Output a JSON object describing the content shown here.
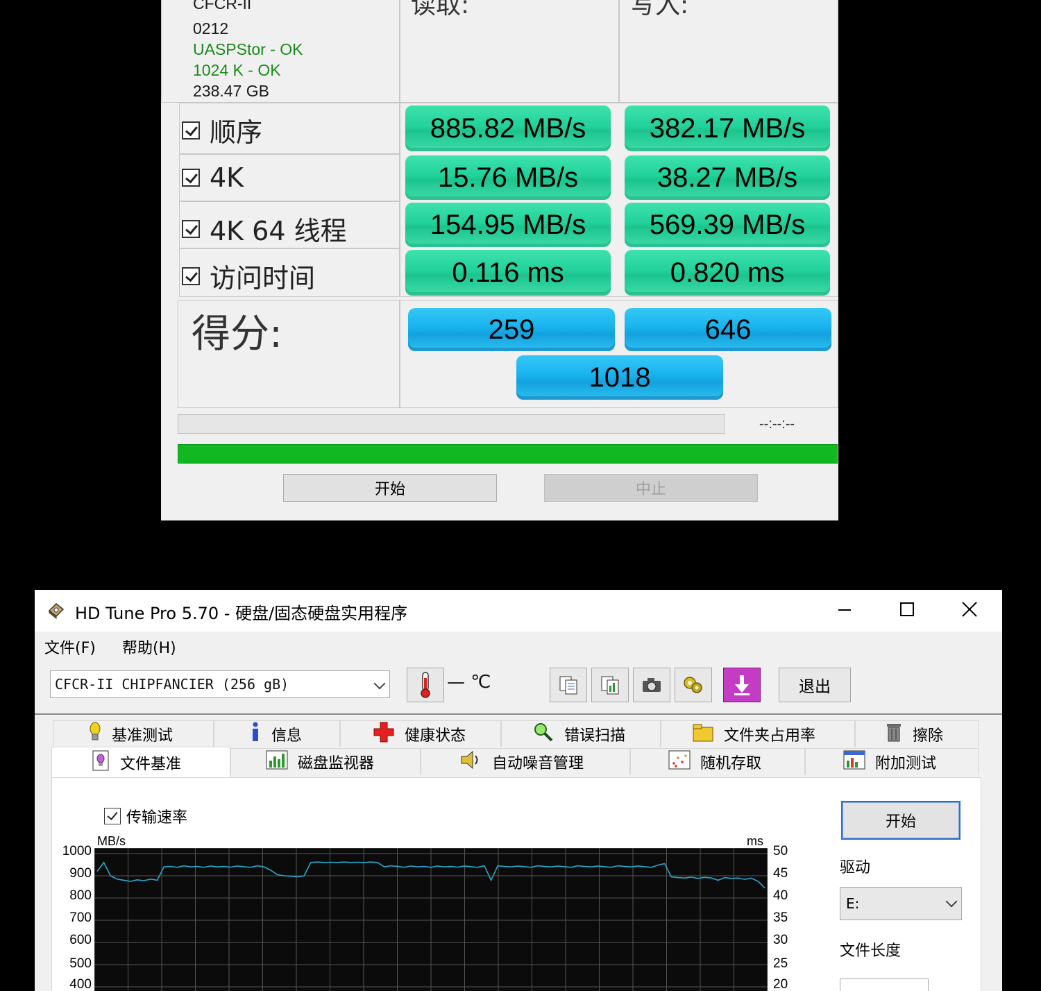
{
  "asssd": {
    "device": {
      "line1": "CFCR-II",
      "line2": "0212",
      "driver_status": "UASPStor - OK",
      "align_status": "1024 K - OK",
      "capacity": "238.47 GB"
    },
    "headers": {
      "read": "读取:",
      "write": "写入:"
    },
    "rows": [
      {
        "label": "顺序",
        "read": "885.82 MB/s",
        "write": "382.17 MB/s",
        "checked": true
      },
      {
        "label": "4K",
        "read": "15.76 MB/s",
        "write": "38.27 MB/s",
        "checked": true
      },
      {
        "label": "4K 64 线程",
        "read": "154.95 MB/s",
        "write": "569.39 MB/s",
        "checked": true
      },
      {
        "label": "访问时间",
        "read": "0.116 ms",
        "write": "0.820 ms",
        "checked": true
      }
    ],
    "score": {
      "label": "得分:",
      "read": "259",
      "write": "646",
      "total": "1018"
    },
    "time_display": "--:--:--",
    "overall_progress": 1.0,
    "buttons": {
      "start": "开始",
      "abort": "中止"
    },
    "colors": {
      "result_green": "#22d19b",
      "score_blue": "#19b2ee",
      "progress_green": "#12b822"
    }
  },
  "hdtune": {
    "title": "HD Tune Pro 5.70 - 硬盘/固态硬盘实用程序",
    "menu": {
      "file": "文件(F)",
      "help": "帮助(H)"
    },
    "toolbar": {
      "drive": "CFCR-II CHIPFANCIER (256 gB)",
      "temperature": "— ℃",
      "icons": [
        "copy-text-icon",
        "copy-info-icon",
        "screenshot-icon",
        "options-icon",
        "save-download-icon"
      ],
      "exit": "退出"
    },
    "tabs_row1": [
      {
        "label": "基准测试",
        "icon": "bulb-icon"
      },
      {
        "label": "信息",
        "icon": "info-icon"
      },
      {
        "label": "健康状态",
        "icon": "health-cross-icon"
      },
      {
        "label": "错误扫描",
        "icon": "magnifier-icon"
      },
      {
        "label": "文件夹占用率",
        "icon": "folder-icon"
      },
      {
        "label": "擦除",
        "icon": "trash-icon"
      }
    ],
    "tabs_row2": [
      {
        "label": "文件基准",
        "icon": "file-benchmark-icon",
        "active": true
      },
      {
        "label": "磁盘监视器",
        "icon": "monitor-chart-icon"
      },
      {
        "label": "自动噪音管理",
        "icon": "speaker-icon"
      },
      {
        "label": "随机存取",
        "icon": "scatter-icon"
      },
      {
        "label": "附加测试",
        "icon": "extra-tests-icon"
      }
    ],
    "transfer_rate_checkbox": "传输速率",
    "start_button": "开始",
    "drive_label": "驱动",
    "drive_value": "E:",
    "file_length_label": "文件长度",
    "chart_data": {
      "type": "line",
      "y_left_unit": "MB/s",
      "y_right_unit": "ms",
      "y_left_ticks": [
        "1000",
        "900",
        "800",
        "700",
        "600",
        "500",
        "400"
      ],
      "y_right_ticks": [
        "50",
        "45",
        "40",
        "35",
        "30",
        "25",
        "20"
      ],
      "ylim": [
        400,
        1000
      ],
      "grid": true,
      "series": [
        {
          "color": "#2aa8c8",
          "x": [
            0,
            1,
            2,
            3,
            4,
            5,
            6,
            7,
            8,
            9,
            10,
            11,
            12,
            13,
            14,
            15,
            16,
            17,
            18,
            19,
            20,
            21,
            22,
            23,
            24,
            25,
            26,
            27,
            28,
            29,
            30,
            31,
            32,
            33,
            34,
            35,
            36,
            37,
            38,
            39,
            40,
            41,
            42,
            43,
            44,
            45,
            46,
            47,
            48,
            49,
            50,
            51,
            52,
            53,
            54,
            55,
            56,
            57,
            58,
            59,
            60,
            61,
            62,
            63,
            64,
            65,
            66,
            67,
            68,
            69,
            70,
            71,
            72,
            73,
            74,
            75,
            76,
            77,
            78,
            79,
            80,
            81,
            82,
            83,
            84,
            85,
            86,
            87,
            88,
            89,
            90,
            91,
            92,
            93,
            94,
            95,
            96,
            97,
            98,
            99,
            100
          ],
          "values": [
            920,
            960,
            900,
            885,
            880,
            875,
            882,
            878,
            885,
            880,
            940,
            942,
            938,
            945,
            940,
            942,
            938,
            944,
            940,
            942,
            939,
            944,
            941,
            938,
            945,
            940,
            925,
            905,
            900,
            898,
            895,
            900,
            960,
            962,
            960,
            961,
            960,
            962,
            960,
            961,
            960,
            962,
            960,
            940,
            945,
            942,
            938,
            944,
            940,
            942,
            938,
            944,
            940,
            942,
            939,
            944,
            941,
            938,
            945,
            880,
            945,
            942,
            940,
            944,
            941,
            938,
            945,
            942,
            940,
            944,
            941,
            938,
            945,
            942,
            940,
            944,
            941,
            938,
            945,
            942,
            940,
            944,
            941,
            938,
            948,
            955,
            895,
            892,
            890,
            894,
            888,
            893,
            890,
            880,
            892,
            888,
            890,
            884,
            889,
            875,
            845
          ]
        }
      ]
    }
  }
}
